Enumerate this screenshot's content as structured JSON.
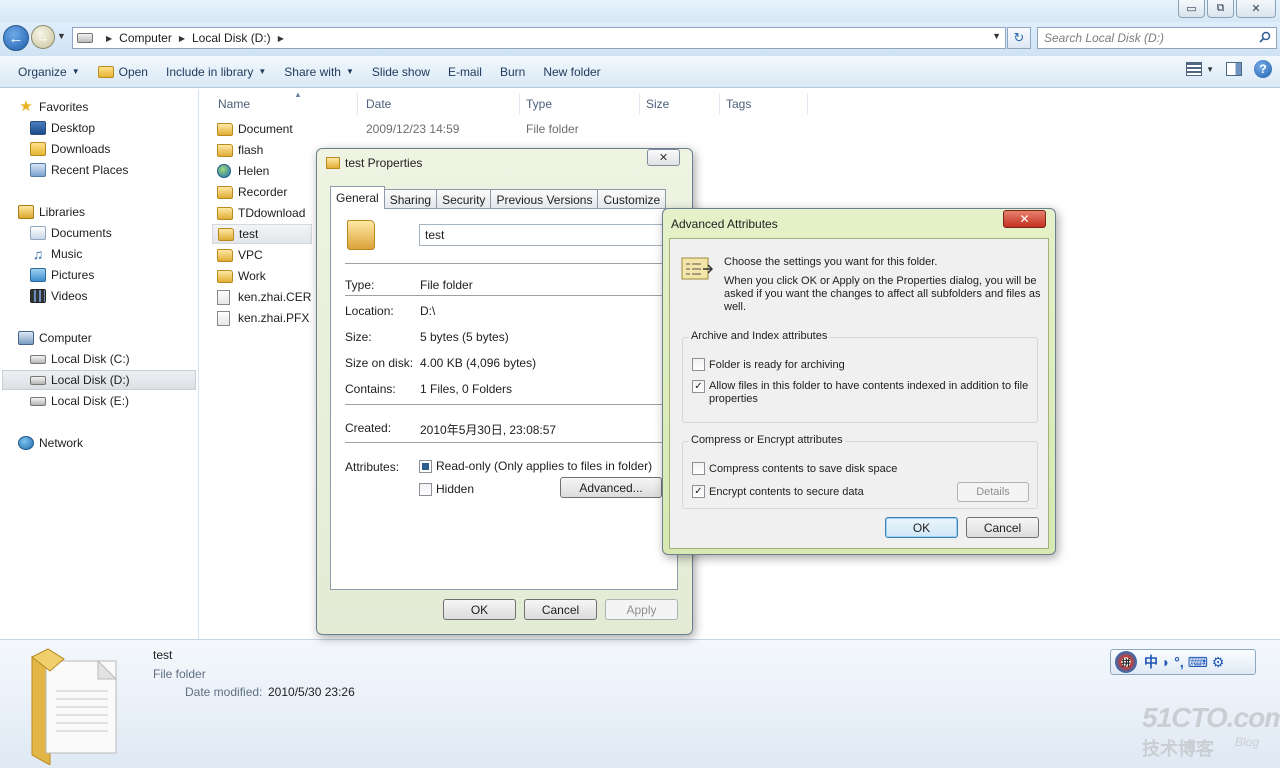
{
  "window": {
    "title_ghost": "",
    "min_label": "▭",
    "max_label": "⧉",
    "close_label": "✕"
  },
  "address": {
    "crumbs": [
      "Computer",
      "Local Disk (D:)"
    ],
    "search_placeholder": "Search Local Disk (D:)"
  },
  "toolbar": {
    "organize": "Organize",
    "open": "Open",
    "include_in_library": "Include in library",
    "share_with": "Share with",
    "slide_show": "Slide show",
    "email": "E-mail",
    "burn": "Burn",
    "new_folder": "New folder"
  },
  "nav": {
    "favorites": "Favorites",
    "desktop": "Desktop",
    "downloads": "Downloads",
    "recent_places": "Recent Places",
    "libraries": "Libraries",
    "documents": "Documents",
    "music": "Music",
    "pictures": "Pictures",
    "videos": "Videos",
    "computer": "Computer",
    "local_c": "Local Disk (C:)",
    "local_d": "Local Disk (D:)",
    "local_e": "Local Disk (E:)",
    "network": "Network"
  },
  "columns": {
    "name": "Name",
    "date": "Date",
    "type": "Type",
    "size": "Size",
    "tags": "Tags"
  },
  "files": [
    {
      "name": "Document",
      "date": "2009/12/23 14:59",
      "type": "File folder"
    },
    {
      "name": "flash",
      "date": "",
      "type": ""
    },
    {
      "name": "Helen",
      "date": "",
      "type": ""
    },
    {
      "name": "Recorder",
      "date": "",
      "type": ""
    },
    {
      "name": "TDdownload",
      "date": "",
      "type": ""
    },
    {
      "name": "test",
      "date": "",
      "type": ""
    },
    {
      "name": "VPC",
      "date": "",
      "type": ""
    },
    {
      "name": "Work",
      "date": "",
      "type": ""
    },
    {
      "name": "ken.zhai.CER",
      "date": "",
      "type": ""
    },
    {
      "name": "ken.zhai.PFX",
      "date": "",
      "type": ""
    }
  ],
  "details": {
    "name": "test",
    "type": "File folder",
    "modified_label": "Date modified:",
    "modified_value": "2010/5/30 23:26"
  },
  "ime": {
    "logo": "拼",
    "chars": "中 ◗ °, ⌨ ⚙"
  },
  "watermark": {
    "main": "51CTO.com",
    "sub": "技术博客",
    "blog": "Blog"
  },
  "props_dialog": {
    "title": "test Properties",
    "close": "✕",
    "tabs": [
      "General",
      "Sharing",
      "Security",
      "Previous Versions",
      "Customize"
    ],
    "name_value": "test",
    "type_label": "Type:",
    "type_value": "File folder",
    "location_label": "Location:",
    "location_value": "D:\\",
    "size_label": "Size:",
    "size_value": "5 bytes (5 bytes)",
    "size_on_disk_label": "Size on disk:",
    "size_on_disk_value": "4.00 KB (4,096 bytes)",
    "contains_label": "Contains:",
    "contains_value": "1 Files, 0 Folders",
    "created_label": "Created:",
    "created_value": "2010年5月30日, 23:08:57",
    "attributes_label": "Attributes:",
    "readonly_label": "Read-only (Only applies to files in folder)",
    "hidden_label": "Hidden",
    "advanced_button": "Advanced...",
    "ok": "OK",
    "cancel": "Cancel",
    "apply": "Apply"
  },
  "adv_dialog": {
    "title": "Advanced Attributes",
    "close": "✕",
    "intro_line1": "Choose the settings you want for this folder.",
    "intro_line2": "When you click OK or Apply on the Properties dialog, you will be asked if you want the changes to affect all subfolders and files as well.",
    "archive_group": "Archive and Index attributes",
    "archive_label": "Folder is ready for archiving",
    "archive_checked": false,
    "index_label": "Allow files in this folder to have contents indexed in addition to file properties",
    "index_checked": true,
    "compress_group": "Compress or Encrypt attributes",
    "compress_label": "Compress contents to save disk space",
    "compress_checked": false,
    "encrypt_label": "Encrypt contents to secure data",
    "encrypt_checked": true,
    "details_button": "Details",
    "ok": "OK",
    "cancel": "Cancel"
  }
}
